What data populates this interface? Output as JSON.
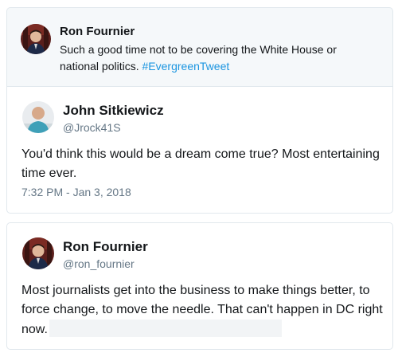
{
  "quoted_tweet": {
    "name": "Ron Fournier",
    "text_line1": "Such a good time not to be covering the White House or",
    "text_line2": "national politics. ",
    "hashtag": "#EvergreenTweet"
  },
  "reply_tweet": {
    "name": "John Sitkiewicz",
    "handle": "@Jrock41S",
    "text": "You'd think this would be a dream come true? Most entertaining time ever.",
    "timestamp": "7:32 PM - Jan 3, 2018"
  },
  "bottom_tweet": {
    "name": "Ron Fournier",
    "handle": "@ron_fournier",
    "text": "Most journalists get into the business to make things better, to force change, to move the needle. That can't happen in DC right now."
  },
  "colors": {
    "hashtag": "#1b95e0",
    "muted": "#657786",
    "border": "#e1e8ed"
  }
}
